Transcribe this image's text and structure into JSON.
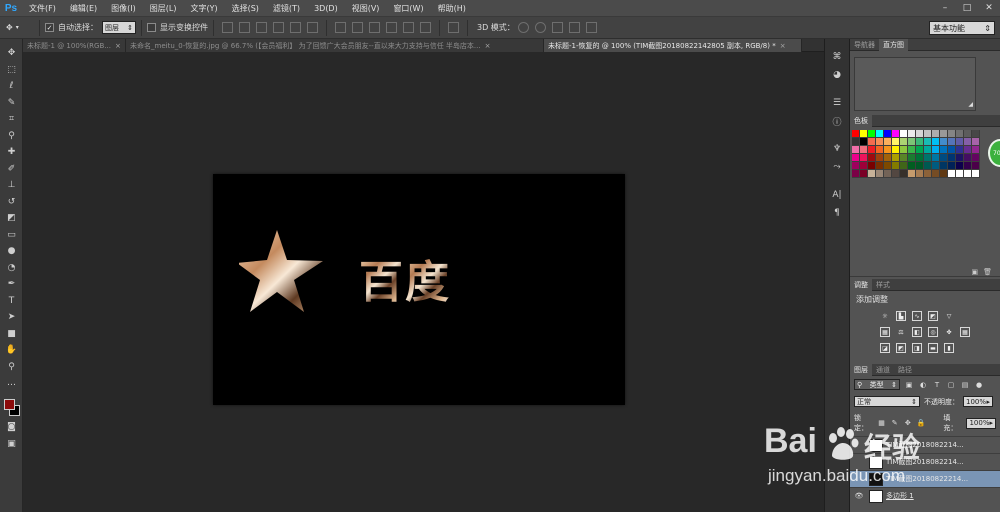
{
  "app": {
    "logo": "Ps"
  },
  "menu": [
    "文件(F)",
    "编辑(E)",
    "图像(I)",
    "图层(L)",
    "文字(Y)",
    "选择(S)",
    "滤镜(T)",
    "3D(D)",
    "视图(V)",
    "窗口(W)",
    "帮助(H)"
  ],
  "window_controls": [
    "–",
    "□",
    "✕"
  ],
  "options": {
    "auto_select_label": "自动选择：",
    "auto_select_value": "图层",
    "show_transform_label": "显示变换控件",
    "mode_3d_label": "3D 模式：",
    "workspace": "基本功能"
  },
  "tabs": [
    {
      "label": "未标题-1 @ 100%(RGB...",
      "active": false
    },
    {
      "label": "未命名_meitu_0-恢复的.jpg @ 66.7% (【会员福利】 为了回馈广大会员朋友--直以来大力支持与信任 半岛店本...",
      "active": false
    },
    {
      "label": "未标题-1-恢复的 @ 100% (TIM截图20180822142805 副本, RGB/8) *",
      "active": true
    }
  ],
  "canvas": {
    "text": [
      "百",
      "度"
    ],
    "colors": {
      "background": "#000000",
      "star_gradient_a": "#f2d4b4",
      "star_gradient_b": "#7a4a2c"
    }
  },
  "foreground_color": "#8b0a0a",
  "background_color": "#000000",
  "panels": {
    "navigator_tabs": [
      "导航器",
      "直方图"
    ],
    "swatches_tab": "色板",
    "adjust_tabs": [
      "调整",
      "样式"
    ],
    "adjust_title": "添加调整",
    "layers_tabs": [
      "图层",
      "通道",
      "路径"
    ],
    "layer_filter": "类型",
    "blend_mode": "正常",
    "opacity_label": "不透明度：",
    "opacity_value": "100%",
    "lock_label": "锁定：",
    "fill_label": "填充：",
    "fill_value": "100%",
    "layers": [
      {
        "name": "TIM截图201808221​4...",
        "selected": false
      },
      {
        "name": "TIM截图201808221​4...",
        "selected": false
      },
      {
        "name": "TIM截图20180822214...",
        "selected": true
      },
      {
        "name": "多边形 1",
        "selected": false
      }
    ],
    "badge": "70"
  },
  "swatch_colors": [
    "#ff0000",
    "#ffff00",
    "#00ff00",
    "#00ffff",
    "#0000ff",
    "#ff00ff",
    "#ffffff",
    "#ebebeb",
    "#d6d6d6",
    "#c2c2c2",
    "#adadad",
    "#999999",
    "#858585",
    "#707070",
    "#5c5c5c",
    "#474747",
    "#333333",
    "#000000",
    "#f26c4f",
    "#f68e56",
    "#fbaf5d",
    "#fff568",
    "#acd372",
    "#7cc576",
    "#3bb878",
    "#1abbb4",
    "#00bff3",
    "#438ccb",
    "#5574b9",
    "#605ca8",
    "#855fa8",
    "#a763a8",
    "#f06ea9",
    "#f26d7d",
    "#ed1c24",
    "#f26522",
    "#f7941d",
    "#fff200",
    "#8dc63f",
    "#39b54a",
    "#00a651",
    "#00a99d",
    "#00aeef",
    "#0072bc",
    "#0054a6",
    "#2e3192",
    "#662d91",
    "#92278f",
    "#ec008c",
    "#ed145b",
    "#9e0b0f",
    "#a0410d",
    "#a3620a",
    "#aba000",
    "#598527",
    "#1a7b30",
    "#007236",
    "#00746b",
    "#0076a3",
    "#004b80",
    "#003471",
    "#1b1464",
    "#440e62",
    "#630460",
    "#9e005d",
    "#9e0039",
    "#790000",
    "#7b2e00",
    "#7d4900",
    "#827b00",
    "#406618",
    "#005e20",
    "#005826",
    "#005952",
    "#005b7f",
    "#003663",
    "#002157",
    "#0d004c",
    "#32004b",
    "#4b0049",
    "#7b0046",
    "#7a0026",
    "#c7b299",
    "#998675",
    "#736357",
    "#534741",
    "#37302a",
    "#c69c6d",
    "#a67c52",
    "#8c6239",
    "#754c24",
    "#603913",
    "#ffffff",
    "#ffffff",
    "#ffffff",
    "#ffffff"
  ],
  "watermark": {
    "brand": "Bai",
    "brand2": "经验",
    "url": "jingyan.baidu.com"
  }
}
